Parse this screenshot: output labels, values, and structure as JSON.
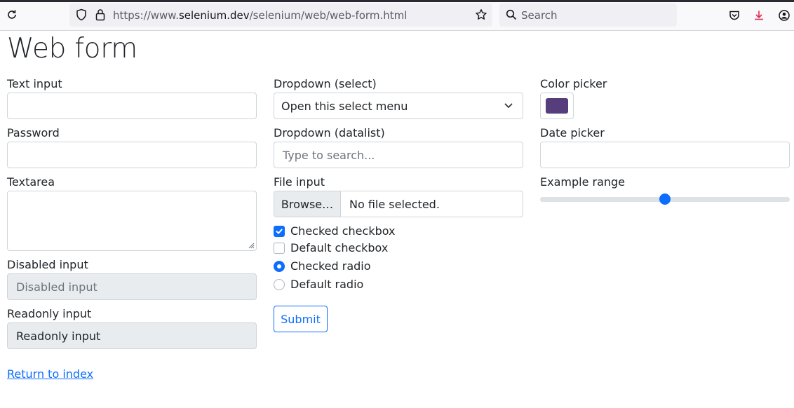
{
  "browser": {
    "url_prefix": "https://www.",
    "url_domain": "selenium.dev",
    "url_path": "/selenium/web/web-form.html",
    "search_placeholder": "Search"
  },
  "page": {
    "title": "Web form",
    "text_input": {
      "label": "Text input",
      "value": ""
    },
    "password": {
      "label": "Password",
      "value": ""
    },
    "textarea": {
      "label": "Textarea",
      "value": ""
    },
    "disabled_input": {
      "label": "Disabled input",
      "placeholder": "Disabled input"
    },
    "readonly_input": {
      "label": "Readonly input",
      "value": "Readonly input"
    },
    "select": {
      "label": "Dropdown (select)",
      "selected": "Open this select menu"
    },
    "datalist": {
      "label": "Dropdown (datalist)",
      "placeholder": "Type to search..."
    },
    "file_input": {
      "label": "File input",
      "button": "Browse…",
      "status": "No file selected."
    },
    "checkboxes": [
      {
        "label": "Checked checkbox",
        "checked": true
      },
      {
        "label": "Default checkbox",
        "checked": false
      }
    ],
    "radios": [
      {
        "label": "Checked radio",
        "checked": true
      },
      {
        "label": "Default radio",
        "checked": false
      }
    ],
    "submit": "Submit",
    "color_picker": {
      "label": "Color picker",
      "value": "#563d7c"
    },
    "date_picker": {
      "label": "Date picker",
      "value": ""
    },
    "range": {
      "label": "Example range",
      "min": 0,
      "max": 10,
      "value": 5
    },
    "return_link": "Return to index"
  },
  "colors": {
    "accent": "#0d6efd"
  }
}
